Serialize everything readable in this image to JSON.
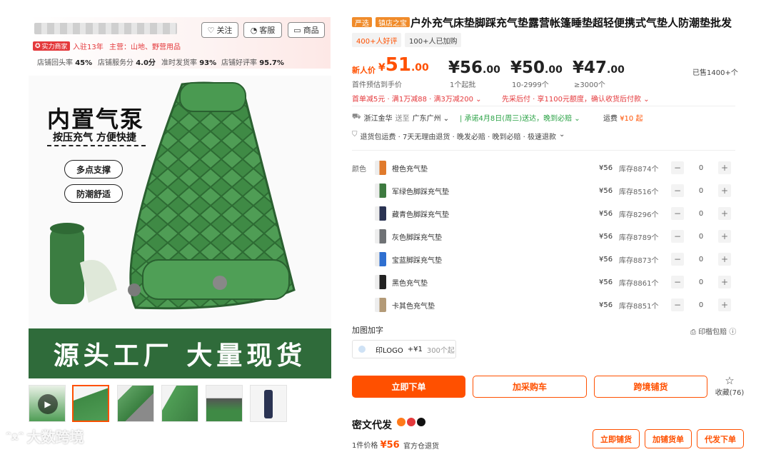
{
  "store": {
    "follow_label": "关注",
    "service_label": "客服",
    "goods_label": "商品",
    "badge": "实力商家",
    "years": "入驻13年",
    "main_business": "主营：山地、野营用品",
    "stats": [
      {
        "label": "店铺回头率",
        "value": "45%"
      },
      {
        "label": "店铺服务分",
        "value": "4.0分"
      },
      {
        "label": "准时发货率",
        "value": "93%"
      },
      {
        "label": "店铺好评率",
        "value": "95.7%"
      }
    ]
  },
  "gallery": {
    "headline": "内置气泵",
    "subline": "按压充气 方便快捷",
    "chip1": "多点支撑",
    "chip2": "防潮舒适",
    "banner": "源头工厂  大量现货"
  },
  "product": {
    "tags": [
      "严选",
      "镇店之宝"
    ],
    "title": "户外充气床垫脚踩充气垫露营帐篷睡垫超轻便携式气垫人防潮垫批发",
    "pills": [
      "400+人好评",
      "100+人已加购"
    ],
    "new_price_label": "新人价",
    "new_price_symbol": "¥",
    "new_price_int": "51",
    "new_price_dec": ".00",
    "new_price_note": "首件预估到手价",
    "tiers": [
      {
        "price": "¥56",
        "dec": ".00",
        "qty": "1个起批"
      },
      {
        "price": "¥50",
        "dec": ".00",
        "qty": "10-2999个"
      },
      {
        "price": "¥47",
        "dec": ".00",
        "qty": "≥3000个"
      }
    ],
    "sold": "已售1400+个",
    "promo1": "首单减5元 · 满1万减88 · 满3万减200",
    "promo2": "先采后付 · 享1100元额度，确认收货后付款",
    "ship_from": "浙江金华",
    "ship_to_prefix": "送至",
    "ship_to": "广东广州",
    "promise": "承诺4月8日(周三)送达，晚到必赔",
    "freight_label": "运费",
    "freight": "¥10 起",
    "guarantee": "退货包运费 · 7天无理由退货 · 晚发必赔 · 晚到必赔 · 极速退款",
    "color_label": "颜色",
    "skus": [
      {
        "name": "橙色充气垫",
        "price": "¥56",
        "stock": "库存8874个",
        "qty": "0",
        "color": "#e07a2c"
      },
      {
        "name": "军绿色脚踩充气垫",
        "price": "¥56",
        "stock": "库存8516个",
        "qty": "0",
        "color": "#3d7a3f"
      },
      {
        "name": "藏青色脚踩充气垫",
        "price": "¥56",
        "stock": "库存8296个",
        "qty": "0",
        "color": "#2a3352"
      },
      {
        "name": "灰色脚踩充气垫",
        "price": "¥56",
        "stock": "库存8789个",
        "qty": "0",
        "color": "#6f7275"
      },
      {
        "name": "宝蓝脚踩充气垫",
        "price": "¥56",
        "stock": "库存8873个",
        "qty": "0",
        "color": "#2f6fd0"
      },
      {
        "name": "黑色充气垫",
        "price": "¥56",
        "stock": "库存8861个",
        "qty": "0",
        "color": "#222222"
      },
      {
        "name": "卡其色充气垫",
        "price": "¥56",
        "stock": "库存8851个",
        "qty": "0",
        "color": "#b39a77"
      }
    ],
    "custom_label": "加图加字",
    "print_pack": "印楷包赔",
    "logo_option": "印LOGO",
    "logo_price": "+¥1",
    "logo_min": "300个起",
    "btn_order": "立即下单",
    "btn_cart": "加采购车",
    "btn_cross": "跨境铺货",
    "fav_label": "收藏",
    "fav_count": "(76)"
  },
  "dropship": {
    "title": "密文代发",
    "price_label": "1件价格",
    "price": "¥56",
    "warehouse": "官方仓退货",
    "btn1": "立即铺货",
    "btn2": "加铺货单",
    "btn3": "代发下单"
  },
  "watermark": "大数跨境",
  "colors": {
    "accent": "#ff5000",
    "green": "#2f6b3a",
    "red": "#e4393c"
  }
}
